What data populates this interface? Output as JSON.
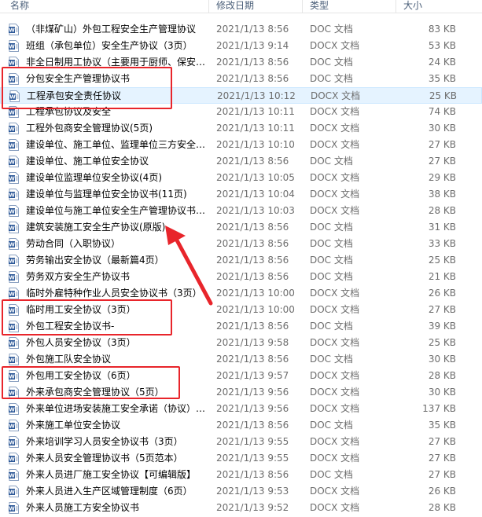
{
  "header": {
    "name": "名称",
    "date": "修改日期",
    "type": "类型",
    "size": "大小"
  },
  "files": [
    {
      "name": "（非煤矿山）外包工程安全生产管理协议",
      "date": "2021/1/13 8:56",
      "type": "DOC 文档",
      "size": "83 KB"
    },
    {
      "name": "班组（承包单位）安全生产协议（3页）",
      "date": "2021/1/13 9:14",
      "type": "DOCX 文档",
      "size": "53 KB"
    },
    {
      "name": "非全日制用工协议（主要用于厨师、保安…",
      "date": "2021/1/13 8:56",
      "type": "DOC 文档",
      "size": "24 KB"
    },
    {
      "name": "分包安全生产管理协议书",
      "date": "2021/1/13 8:56",
      "type": "DOC 文档",
      "size": "35 KB"
    },
    {
      "name": "工程承包安全责任协议",
      "date": "2021/1/13 10:12",
      "type": "DOCX 文档",
      "size": "25 KB"
    },
    {
      "name": "工程承包协议及安全",
      "date": "2021/1/13 10:11",
      "type": "DOCX 文档",
      "size": "74 KB"
    },
    {
      "name": "工程外包商安全管理协议(5页)",
      "date": "2021/1/13 10:11",
      "type": "DOCX 文档",
      "size": "30 KB"
    },
    {
      "name": "建设单位、施工单位、监理单位三方安全…",
      "date": "2021/1/13 10:10",
      "type": "DOCX 文档",
      "size": "27 KB"
    },
    {
      "name": "建设单位、施工单位安全协议",
      "date": "2021/1/13 8:56",
      "type": "DOC 文档",
      "size": "27 KB"
    },
    {
      "name": "建设单位监理单位安全协议(4页)",
      "date": "2021/1/13 10:05",
      "type": "DOCX 文档",
      "size": "29 KB"
    },
    {
      "name": "建设单位与监理单位安全协议书(11页)",
      "date": "2021/1/13 10:04",
      "type": "DOCX 文档",
      "size": "38 KB"
    },
    {
      "name": "建设单位与施工单位安全生产管理协议书…",
      "date": "2021/1/13 10:03",
      "type": "DOCX 文档",
      "size": "28 KB"
    },
    {
      "name": "建筑安装施工安全生产协议(原版)",
      "date": "2021/1/13 8:56",
      "type": "DOC 文档",
      "size": "31 KB"
    },
    {
      "name": "劳动合同（入职协议）",
      "date": "2021/1/13 8:56",
      "type": "DOC 文档",
      "size": "33 KB"
    },
    {
      "name": "劳务输出安全协议（最新篇4页）",
      "date": "2021/1/13 8:56",
      "type": "DOC 文档",
      "size": "25 KB"
    },
    {
      "name": "劳务双方安全生产协议书",
      "date": "2021/1/13 8:56",
      "type": "DOC 文档",
      "size": "21 KB"
    },
    {
      "name": "临时外雇特种作业人员安全协议书（3页）",
      "date": "2021/1/13 10:00",
      "type": "DOCX 文档",
      "size": "26 KB"
    },
    {
      "name": "临时用工安全协议（3页）",
      "date": "2021/1/13 10:00",
      "type": "DOCX 文档",
      "size": "27 KB"
    },
    {
      "name": "外包工程安全协议书-",
      "date": "2021/1/13 8:56",
      "type": "DOC 文档",
      "size": "39 KB"
    },
    {
      "name": "外包人员安全协议（3页）",
      "date": "2021/1/13 9:58",
      "type": "DOCX 文档",
      "size": "25 KB"
    },
    {
      "name": "外包施工队安全协议",
      "date": "2021/1/13 8:56",
      "type": "DOC 文档",
      "size": "30 KB"
    },
    {
      "name": "外包用工安全协议（6页）",
      "date": "2021/1/13 9:57",
      "type": "DOCX 文档",
      "size": "28 KB"
    },
    {
      "name": "外来承包商安全管理协议（5页）",
      "date": "2021/1/13 9:56",
      "type": "DOCX 文档",
      "size": "30 KB"
    },
    {
      "name": "外来单位进场安装施工安全承诺（协议）…",
      "date": "2021/1/13 9:56",
      "type": "DOCX 文档",
      "size": "137 KB"
    },
    {
      "name": "外来施工单位安全协议",
      "date": "2021/1/13 8:56",
      "type": "DOC 文档",
      "size": "35 KB"
    },
    {
      "name": "外来培训学习人员安全协议书（3页）",
      "date": "2021/1/13 9:55",
      "type": "DOCX 文档",
      "size": "27 KB"
    },
    {
      "name": "外来人员安全管理协议书（5页范本）",
      "date": "2021/1/13 9:55",
      "type": "DOCX 文档",
      "size": "27 KB"
    },
    {
      "name": "外来人员进厂施工安全协议【可编辑版】",
      "date": "2021/1/13 8:56",
      "type": "DOC 文档",
      "size": "27 KB"
    },
    {
      "name": "外来人员进入生产区域管理制度（6页）",
      "date": "2021/1/13 9:53",
      "type": "DOCX 文档",
      "size": "26 KB"
    },
    {
      "name": "外来人员施工方安全协议书",
      "date": "2021/1/13 9:52",
      "type": "DOCX 文档",
      "size": "28 KB"
    }
  ],
  "selected_index": 4,
  "colors": {
    "highlight_box": "#e8252b",
    "selection": "#e5f3ff",
    "word_icon": "#2b5797"
  }
}
